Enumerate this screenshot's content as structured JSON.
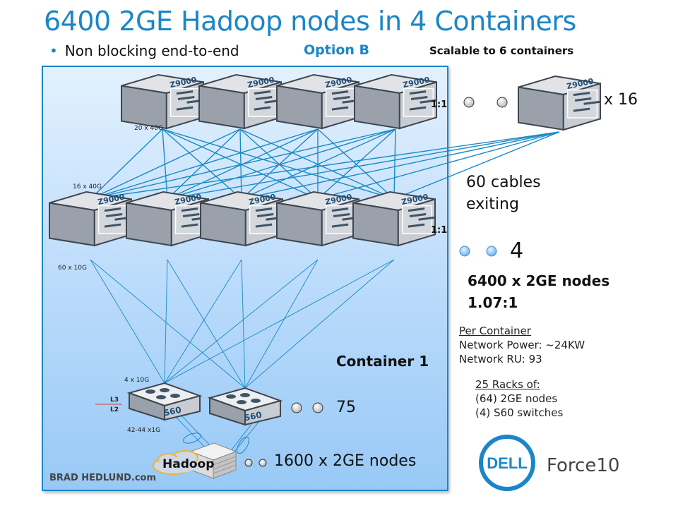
{
  "slide": {
    "title": "6400 2GE Hadoop nodes in 4 Containers",
    "bullet": "Non blocking end-to-end",
    "option": "Option B",
    "scalable_note": "Scalable to 6 containers"
  },
  "container": {
    "label": "Container 1",
    "spine_switch_label": "Z9000",
    "leaf_switch_label": "Z9000",
    "tor_switch_label": "S60",
    "spine_ratio": "1:1",
    "leaf_ratio": "1:1",
    "link_labels": {
      "spine_ports": "20 x 40G",
      "leaf_uplinks": "16 x 40G",
      "leaf_downlinks": "60 x 10G",
      "tor_uplinks": "4 x 10G",
      "tor_downlinks": "42-44 x1G",
      "layer_l3": "L3",
      "layer_l2": "L2"
    },
    "tor_count": "75",
    "nodes": "1600 x 2GE nodes",
    "hadoop_label": "Hadoop"
  },
  "external": {
    "spine_multiplier": "x 16",
    "cables_exiting": "60 cables exiting",
    "container_count": "4",
    "total_nodes": "6400 x 2GE nodes",
    "oversubscription": "1.07:1"
  },
  "per_container": {
    "heading": "Per Container",
    "power": "Network Power: ~24KW",
    "ru": "Network RU: 93",
    "racks_heading": "25 Racks of:",
    "racks_nodes": "(64) 2GE nodes",
    "racks_switches": "(4) S60 switches"
  },
  "branding": {
    "credit": "BRAD HEDLUND.com",
    "logo": "DELL",
    "product": "Force10"
  },
  "colors": {
    "accent": "#1a86c8",
    "link": "#1a8ac6",
    "switch_face": "#c9ccd2",
    "switch_side": "#9aa1ab",
    "switch_label": "#1f4f78"
  }
}
